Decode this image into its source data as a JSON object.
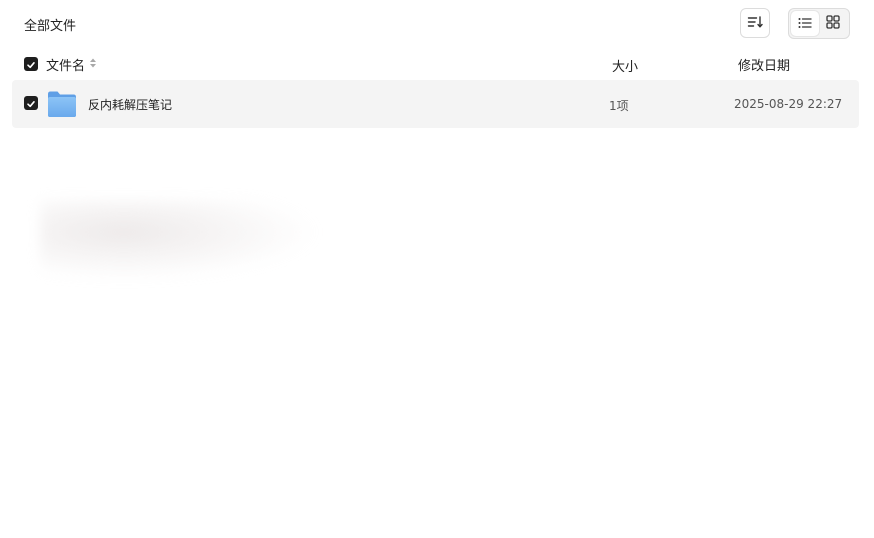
{
  "breadcrumb": {
    "label": "全部文件"
  },
  "toolbar": {
    "sort_icon": "sort-icon",
    "view_list_icon": "list-view-icon",
    "view_grid_icon": "grid-view-icon",
    "active_view": "list"
  },
  "table": {
    "columns": {
      "name": "文件名",
      "size": "大小",
      "modified": "修改日期"
    },
    "select_all_checked": true,
    "rows": [
      {
        "icon": "folder-icon",
        "name": "反内耗解压笔记",
        "size": "1项",
        "modified": "2025-08-29 22:27",
        "checked": true
      }
    ]
  },
  "colors": {
    "row_bg": "#f4f4f4",
    "checkbox": "#1e1e1e",
    "folder": "#7fb9f2"
  }
}
